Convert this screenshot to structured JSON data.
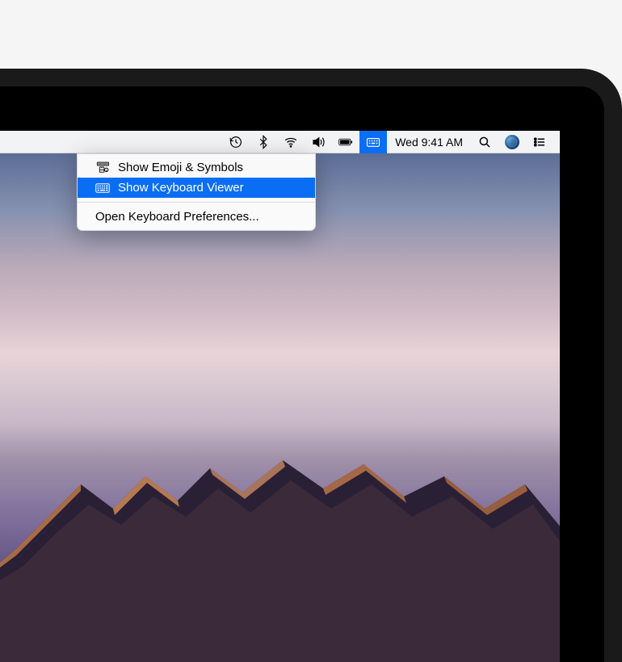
{
  "menubar": {
    "clock": "Wed 9:41 AM"
  },
  "dropdown": {
    "items": [
      {
        "label": "Show Emoji & Symbols"
      },
      {
        "label": "Show Keyboard Viewer"
      },
      {
        "label": "Open Keyboard Preferences..."
      }
    ]
  },
  "colors": {
    "highlight": "#0a6ef5"
  }
}
